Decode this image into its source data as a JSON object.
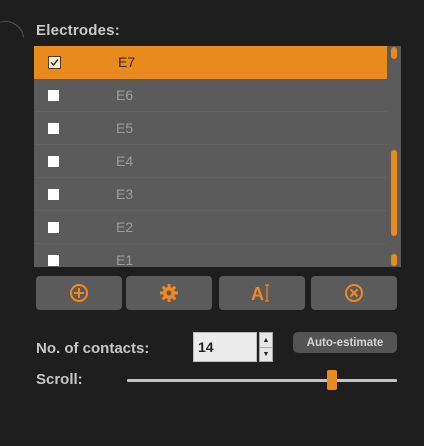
{
  "electrodes": {
    "title": "Electrodes:",
    "items": [
      {
        "label": "E7",
        "checked": true,
        "selected": true
      },
      {
        "label": "E6",
        "checked": false,
        "selected": false
      },
      {
        "label": "E5",
        "checked": false,
        "selected": false
      },
      {
        "label": "E4",
        "checked": false,
        "selected": false
      },
      {
        "label": "E3",
        "checked": false,
        "selected": false
      },
      {
        "label": "E2",
        "checked": false,
        "selected": false
      },
      {
        "label": "E1",
        "checked": false,
        "selected": false
      }
    ]
  },
  "toolbar": {
    "buttons": [
      {
        "name": "add-button",
        "icon": "plus-circle-icon",
        "glyph": "⊕"
      },
      {
        "name": "settings-button",
        "icon": "gear-icon",
        "glyph": "⚙"
      },
      {
        "name": "rename-button",
        "icon": "text-cursor-icon",
        "glyph": "A"
      },
      {
        "name": "remove-button",
        "icon": "close-circle-icon",
        "glyph": "⊗"
      }
    ]
  },
  "contacts": {
    "label": "No. of contacts:",
    "value": "14",
    "auto_label": "Auto-estimate"
  },
  "scroll": {
    "label": "Scroll:",
    "position_fraction": 0.76
  },
  "colors": {
    "accent": "#e88a1e",
    "panel": "#1e1e1e",
    "list_bg": "#5b5b5b"
  }
}
